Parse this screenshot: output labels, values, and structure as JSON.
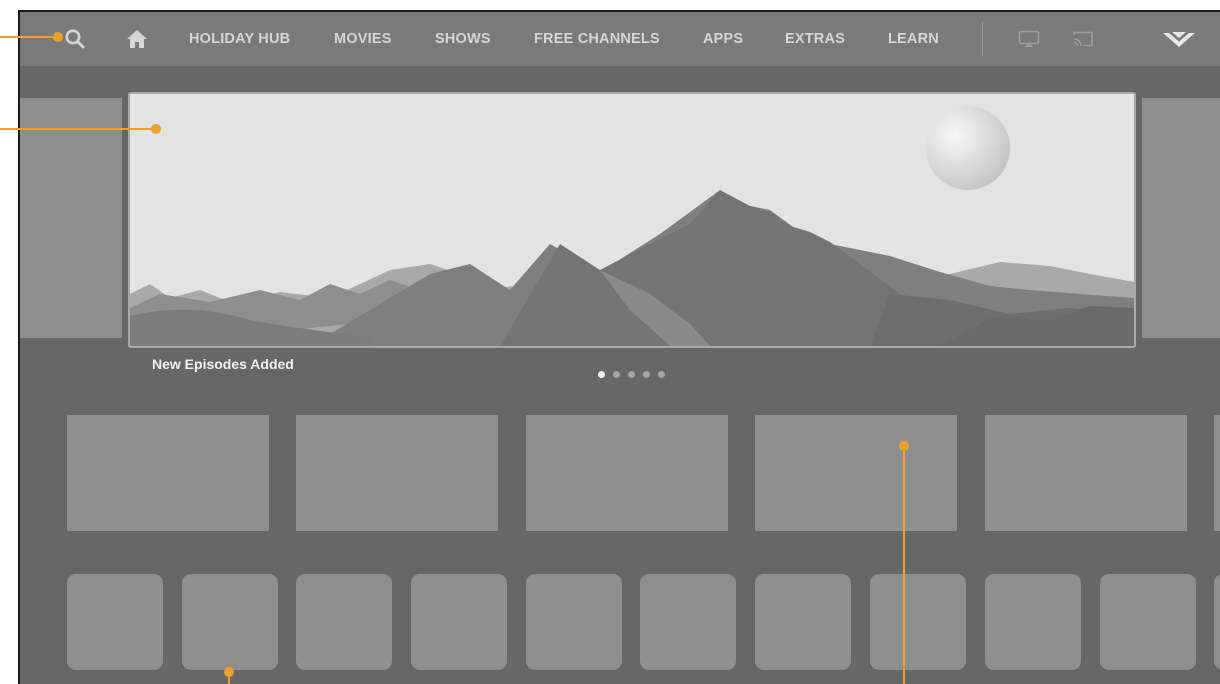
{
  "nav": {
    "items": [
      {
        "label": "HOLIDAY HUB"
      },
      {
        "label": "MOVIES"
      },
      {
        "label": "SHOWS"
      },
      {
        "label": "FREE CHANNELS"
      },
      {
        "label": "APPS"
      },
      {
        "label": "EXTRAS"
      },
      {
        "label": "LEARN"
      }
    ],
    "icons": [
      "search-icon",
      "home-icon",
      "airplay-icon",
      "cast-icon",
      "vizio-logo-icon"
    ]
  },
  "hero": {
    "title": "New Episodes Added",
    "slides_total": 5,
    "active_slide": 1
  },
  "colors": {
    "accent_callout": "#f0a028",
    "background": "#676767",
    "nav_background": "#7a7a7a",
    "tile": "#8f8f8f"
  }
}
